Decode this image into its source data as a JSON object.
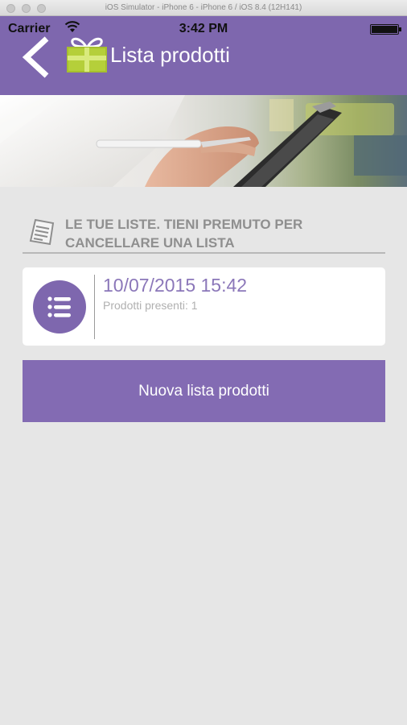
{
  "simulator": {
    "title": "iOS Simulator - iPhone 6 - iPhone 6 / iOS 8.4 (12H141)"
  },
  "status_bar": {
    "carrier": "Carrier",
    "time": "3:42 PM"
  },
  "nav": {
    "title": "Lista prodotti",
    "back_icon": "chevron-left-icon",
    "logo_icon": "gift-icon"
  },
  "section": {
    "title": "LE TUE LISTE. TIENI PREMUTO PER CANCELLARE UNA LISTA",
    "icon": "list-document-icon"
  },
  "lists": [
    {
      "date": "10/07/2015 15:42",
      "products": "Prodotti presenti: 1",
      "icon": "list-icon"
    }
  ],
  "actions": {
    "new_list": "Nuova lista prodotti"
  },
  "colors": {
    "accent": "#7e67ae",
    "gift_green": "#b5cf3a",
    "background": "#e6e6e6"
  }
}
